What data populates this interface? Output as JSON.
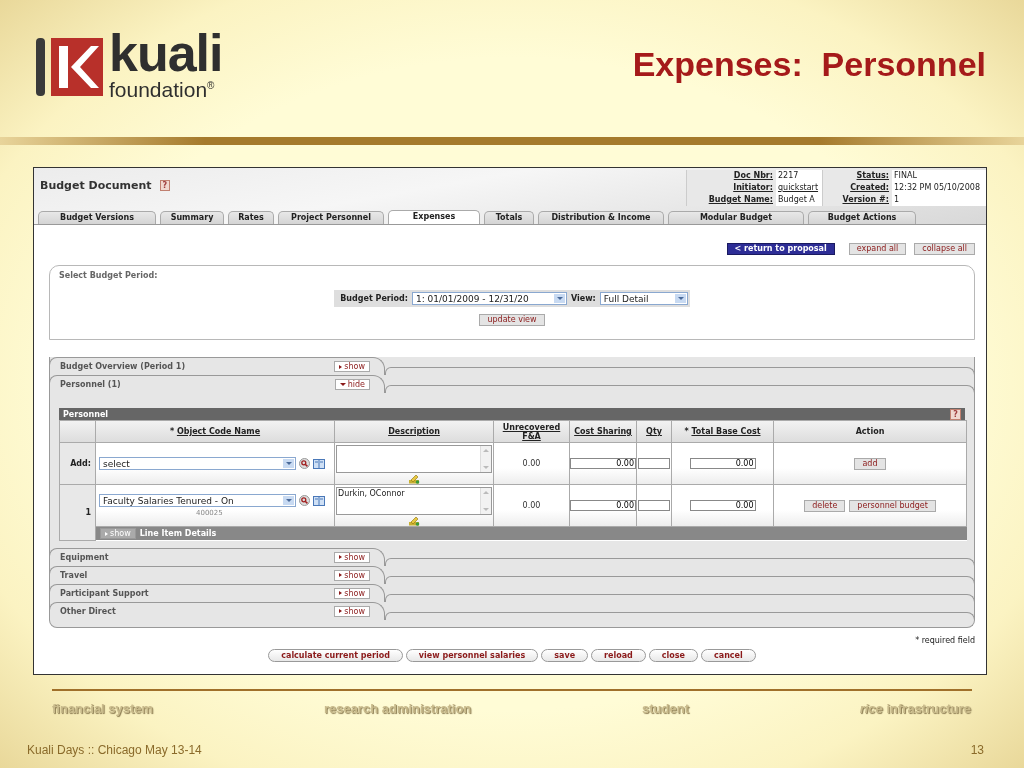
{
  "slide": {
    "title": "Expenses:  Personnel",
    "logo": {
      "name": "kuali",
      "tagline": "foundation$^{®}$"
    }
  },
  "app": {
    "document_title": "Budget Document",
    "help": "?",
    "doc_info": [
      {
        "label": "Doc Nbr:",
        "value": "2217",
        "link": false
      },
      {
        "label": "Status:",
        "value": "FINAL",
        "link": false
      },
      {
        "label": "Initiator:",
        "value": "quickstart",
        "link": true
      },
      {
        "label": "Created:",
        "value": "12:32 PM 05/10/2008",
        "link": false
      },
      {
        "label": "Budget Name:",
        "value": "Budget A",
        "link": false
      },
      {
        "label": "Version #:",
        "value": "1",
        "link": false
      }
    ],
    "tabs": [
      {
        "label": "Budget Versions",
        "selected": false
      },
      {
        "label": "Summary",
        "selected": false
      },
      {
        "label": "Rates",
        "selected": false
      },
      {
        "label": "Project Personnel",
        "selected": false
      },
      {
        "label": "Expenses",
        "selected": true
      },
      {
        "label": "Totals",
        "selected": false
      },
      {
        "label": "Distribution & Income",
        "selected": false
      },
      {
        "label": "Modular Budget",
        "selected": false
      },
      {
        "label": "Budget Actions",
        "selected": false
      }
    ],
    "top_buttons": [
      {
        "label": "< return to proposal",
        "kind": "primary"
      },
      {
        "label": "expand all",
        "kind": "plain"
      },
      {
        "label": "collapse all",
        "kind": "plain"
      }
    ],
    "period_panel": {
      "title": "Select Budget Period:",
      "period_label": "Budget Period:",
      "period_value": "1: 01/01/2009 - 12/31/20",
      "view_label": "View:",
      "view_value": "Full Detail",
      "button": "update view"
    },
    "sections": [
      {
        "title": "Budget Overview (Period 1)",
        "toggle": "show",
        "expanded": false
      },
      {
        "title": "Personnel (1)",
        "toggle": "hide",
        "expanded": true,
        "table": {
          "title": "Personnel",
          "help": "?",
          "columns": [
            {
              "marker": "*",
              "label": "Object Code Name",
              "link": true
            },
            {
              "label": "Description",
              "link": true
            },
            {
              "label": "Unrecovered F&A",
              "link": true
            },
            {
              "label": "Cost Sharing",
              "link": true
            },
            {
              "label": "Qty",
              "link": true
            },
            {
              "marker": "*",
              "label": "Total Base Cost",
              "link": true
            },
            {
              "label": "Action",
              "link": false
            }
          ],
          "rows": [
            {
              "header": "Add:",
              "object_code": "select",
              "unrecovered": "0.00",
              "cost_sharing": "0.00",
              "total": "0.00",
              "actions": [
                "add"
              ]
            },
            {
              "header": "1",
              "object_code": "Faculty Salaries Tenured - On",
              "code": "400025",
              "description": "Durkin, OConnor",
              "unrecovered": "0.00",
              "cost_sharing": "0.00",
              "total": "0.00",
              "actions": [
                "delete",
                "personnel budget"
              ],
              "details": {
                "toggle": "show",
                "expanded": false,
                "label": "Line Item Details"
              }
            }
          ]
        }
      },
      {
        "title": "Equipment",
        "toggle": "show",
        "expanded": false
      },
      {
        "title": "Travel",
        "toggle": "show",
        "expanded": false
      },
      {
        "title": "Participant Support",
        "toggle": "show",
        "expanded": false
      },
      {
        "title": "Other Direct",
        "toggle": "show",
        "expanded": false
      }
    ],
    "required_note": "* required field",
    "bottom_buttons": [
      "calculate current period",
      "view personnel salaries",
      "save",
      "reload",
      "close",
      "cancel"
    ]
  },
  "footer": {
    "products": [
      "financial system",
      "research administration",
      "student",
      "*rice* infrastructure"
    ],
    "event": "Kuali Days :: Chicago May 13-14",
    "page": "13"
  }
}
